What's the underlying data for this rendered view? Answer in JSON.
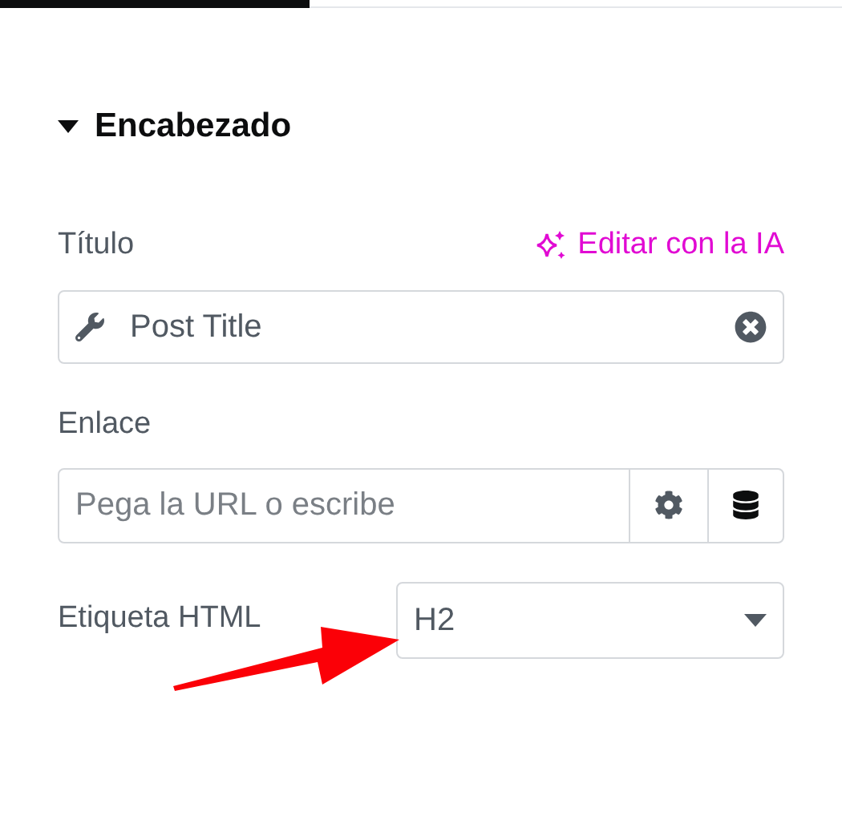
{
  "tabs": [
    {
      "selected": true
    },
    {
      "selected": false
    }
  ],
  "section": {
    "title": "Encabezado",
    "expanded": true
  },
  "title_field": {
    "label": "Título",
    "ai_link": "Editar con la IA",
    "value": "Post Title"
  },
  "link_field": {
    "label": "Enlace",
    "placeholder": "Pega la URL o escribe"
  },
  "html_tag": {
    "label": "Etiqueta HTML",
    "value": "H2"
  }
}
